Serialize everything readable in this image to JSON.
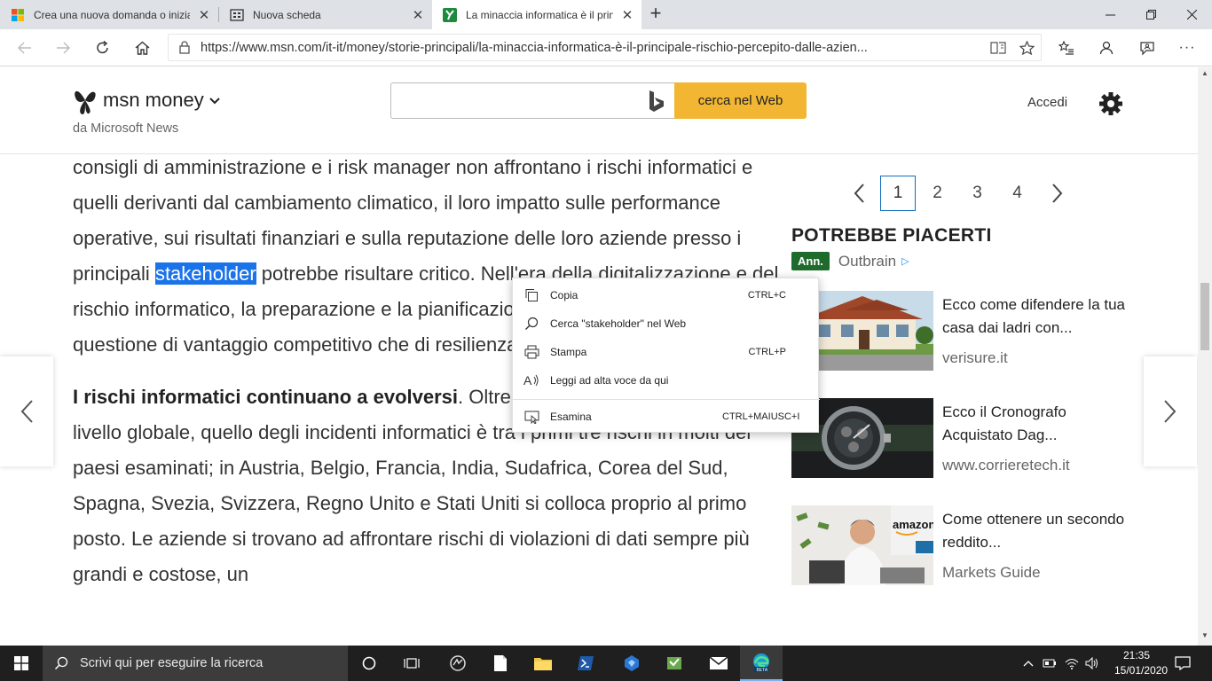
{
  "browser": {
    "tabs": [
      {
        "title": "Crea una nuova domanda o inizia una discussione",
        "active": false
      },
      {
        "title": "Nuova scheda",
        "active": false
      },
      {
        "title": "La minaccia informatica è il principale rischio percepito",
        "active": true
      }
    ],
    "url": "https://www.msn.com/it-it/money/storie-principali/la-minaccia-informatica-è-il-principale-rischio-percepito-dalle-azien..."
  },
  "header": {
    "logo": "msn money",
    "subtitle": "da Microsoft News",
    "search_placeholder": "",
    "search_button": "cerca nel Web",
    "signin": "Accedi"
  },
  "article": {
    "p1_before": "consigli di amministrazione e i risk manager non affrontano i rischi informatici e quelli derivanti dal cambiamento climatico, il loro impatto sulle performance operative, sui risultati finanziari e sulla reputazione delle loro aziende presso i principali ",
    "p1_selected": "stakeholder",
    "p1_after": " potrebbe risultare critico. Nell'era della digitalizzazione e del rischio informatico, la preparazione e la pianificazione di tali rischi è diventata una questione di vantaggio competitivo che di resilienza.",
    "p2_bold": "I rischi informatici continuano a evolversi",
    "p2_rest": ". Oltre a essere il primo rischio a livello globale, quello degli incidenti informatici è tra i primi tre rischi in molti dei paesi esaminati; in Austria, Belgio, Francia, India, Sudafrica, Corea del Sud, Spagna, Svezia, Svizzera, Regno Unito e Stati Uniti si colloca proprio al primo posto. Le aziende si trovano ad affrontare rischi di violazioni di dati sempre più grandi e costose, un"
  },
  "pager": {
    "pages": [
      "1",
      "2",
      "3",
      "4"
    ],
    "current": "1"
  },
  "recommend": {
    "title": "POTREBBE PIACERTI",
    "badge": "Ann.",
    "provider": "Outbrain",
    "cards": [
      {
        "title": "Ecco come difendere la tua casa dai ladri con...",
        "source": "verisure.it"
      },
      {
        "title": "Ecco il Cronografo Acquistato Dag...",
        "source": "www.corrieretech.it"
      },
      {
        "title": "Come ottenere un secondo reddito...",
        "source": "Markets Guide"
      }
    ]
  },
  "context_menu": {
    "items": [
      {
        "label": "Copia",
        "shortcut": "CTRL+C"
      },
      {
        "label": "Cerca \"stakeholder\" nel Web",
        "shortcut": ""
      },
      {
        "label": "Stampa",
        "shortcut": "CTRL+P"
      },
      {
        "label": "Leggi ad alta voce da qui",
        "shortcut": ""
      },
      {
        "label": "Esamina",
        "shortcut": "CTRL+MAIUSC+I"
      }
    ]
  },
  "taskbar": {
    "search_placeholder": "Scrivi qui per eseguire la ricerca",
    "time": "21:35",
    "date": "15/01/2020"
  }
}
